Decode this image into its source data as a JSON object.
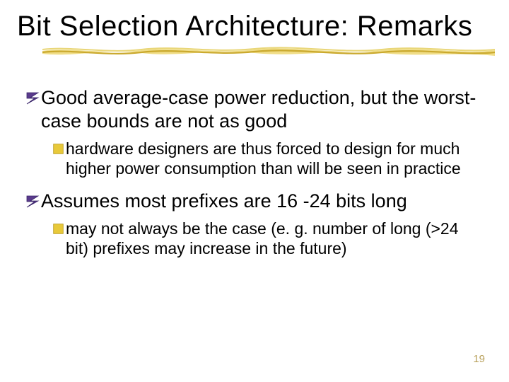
{
  "title": "Bit Selection Architecture: Remarks",
  "bullets": [
    {
      "text": "Good average-case power reduction, but the worst-case bounds are not as good",
      "sub": [
        {
          "text": "hardware designers are thus forced to design for much higher power consumption than will be seen in practice"
        }
      ]
    },
    {
      "text": "Assumes most prefixes are 16 -24 bits long",
      "sub": [
        {
          "text": "may not always be the case (e. g. number of long (>24 bit) prefixes may increase in the future)"
        }
      ]
    }
  ],
  "page_number": "19",
  "colors": {
    "bullet1_fill": "#5a3b8c",
    "bullet1_stroke": "#3a256a",
    "bullet2_fill": "#e8c93a",
    "bullet2_stroke": "#b89a1f",
    "underline_light": "#f3e6a8",
    "underline_dark": "#d7b93e"
  }
}
